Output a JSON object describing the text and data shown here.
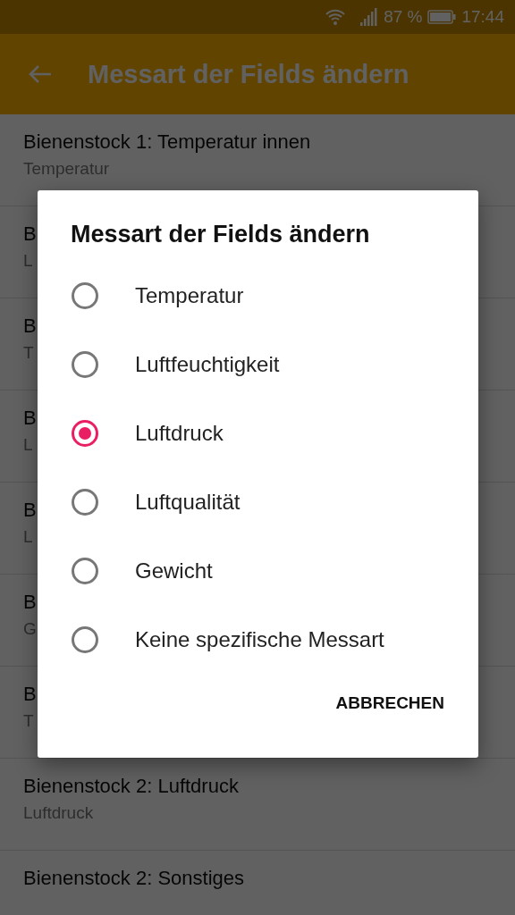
{
  "status_bar": {
    "battery_text": "87 %",
    "time": "17:44"
  },
  "app_bar": {
    "title": "Messart der Fields ändern"
  },
  "list": [
    {
      "title": "Bienenstock 1: Temperatur innen",
      "subtitle": "Temperatur"
    },
    {
      "title": "B",
      "subtitle": "L"
    },
    {
      "title": "B",
      "subtitle": "T"
    },
    {
      "title": "B",
      "subtitle": "L"
    },
    {
      "title": "B",
      "subtitle": "L"
    },
    {
      "title": "B",
      "subtitle": "G"
    },
    {
      "title": "B",
      "subtitle": "T"
    },
    {
      "title": "Bienenstock 2: Luftdruck",
      "subtitle": "Luftdruck"
    },
    {
      "title": "Bienenstock 2: Sonstiges"
    }
  ],
  "dialog": {
    "title": "Messart der Fields ändern",
    "options": [
      {
        "label": "Temperatur",
        "selected": false
      },
      {
        "label": "Luftfeuchtigkeit",
        "selected": false
      },
      {
        "label": "Luftdruck",
        "selected": true
      },
      {
        "label": "Luftqualität",
        "selected": false
      },
      {
        "label": "Gewicht",
        "selected": false
      },
      {
        "label": "Keine spezifische Messart",
        "selected": false
      }
    ],
    "buttons": [
      "ABBRECHEN"
    ]
  }
}
